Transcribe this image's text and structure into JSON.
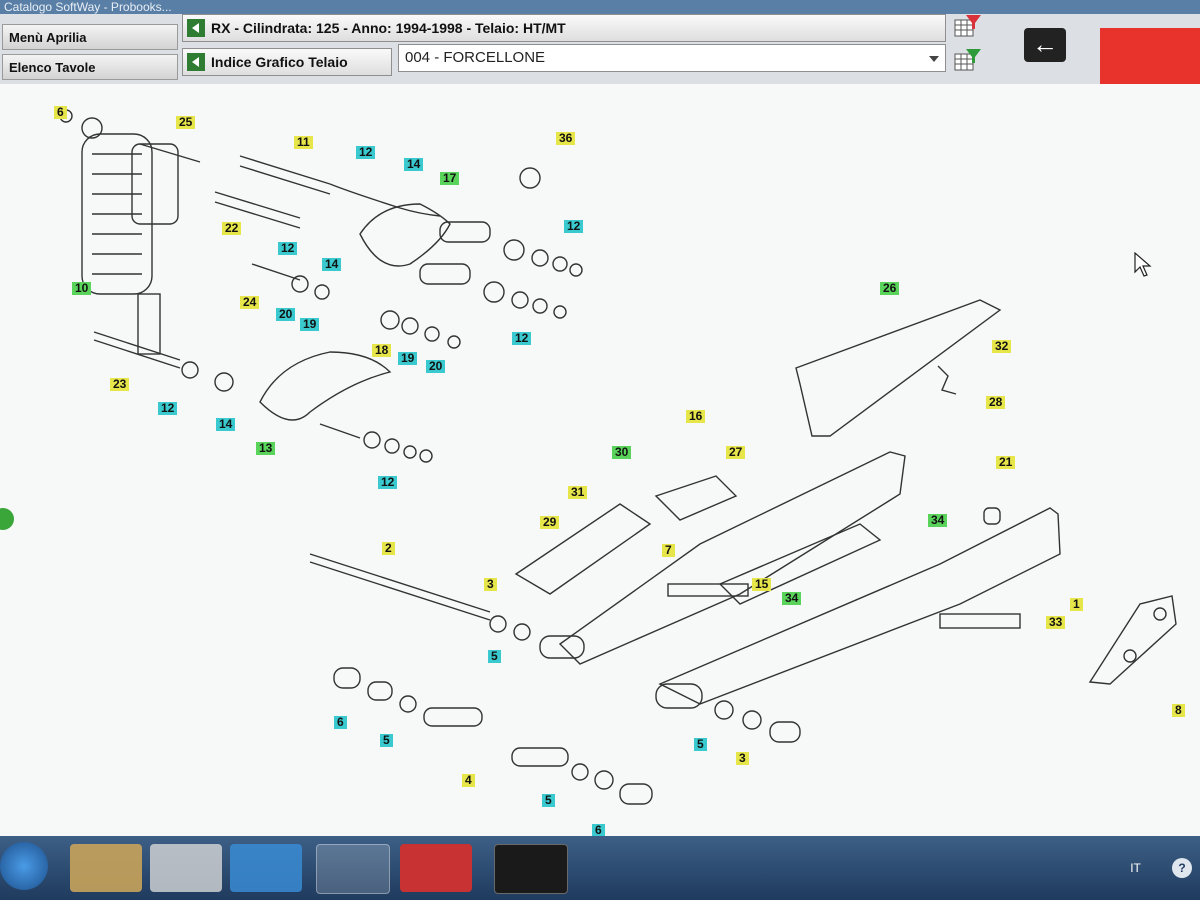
{
  "window": {
    "title": "Catalogo SoftWay - Probooks..."
  },
  "nav": {
    "menu_label": "Menù Aprilia",
    "tables_label": "Elenco Tavole"
  },
  "breadcrumb": {
    "model": "RX - Cilindrata:  125 - Anno: 1994-1998 - Telaio: HT/MT",
    "index": "Indice Grafico Telaio",
    "table": "004 - FORCELLONE"
  },
  "colors": {
    "tag_yellow": "#e6e54a",
    "tag_cyan": "#39c9cf",
    "tag_green": "#5ad35a",
    "header_red": "#e8322c"
  },
  "diagram": {
    "tags": [
      {
        "n": "6",
        "c": "y"
      },
      {
        "n": "25",
        "c": "y"
      },
      {
        "n": "11",
        "c": "y"
      },
      {
        "n": "12",
        "c": "c"
      },
      {
        "n": "14",
        "c": "c"
      },
      {
        "n": "17",
        "c": "g"
      },
      {
        "n": "36",
        "c": "y"
      },
      {
        "n": "22",
        "c": "y"
      },
      {
        "n": "12",
        "c": "c"
      },
      {
        "n": "14",
        "c": "c"
      },
      {
        "n": "12",
        "c": "c"
      },
      {
        "n": "24",
        "c": "y"
      },
      {
        "n": "20",
        "c": "c"
      },
      {
        "n": "19",
        "c": "c"
      },
      {
        "n": "10",
        "c": "g"
      },
      {
        "n": "18",
        "c": "y"
      },
      {
        "n": "19",
        "c": "c"
      },
      {
        "n": "20",
        "c": "c"
      },
      {
        "n": "12",
        "c": "c"
      },
      {
        "n": "23",
        "c": "y"
      },
      {
        "n": "12",
        "c": "c"
      },
      {
        "n": "14",
        "c": "c"
      },
      {
        "n": "13",
        "c": "g"
      },
      {
        "n": "12",
        "c": "c"
      },
      {
        "n": "26",
        "c": "g"
      },
      {
        "n": "32",
        "c": "y"
      },
      {
        "n": "28",
        "c": "y"
      },
      {
        "n": "16",
        "c": "y"
      },
      {
        "n": "30",
        "c": "g"
      },
      {
        "n": "27",
        "c": "y"
      },
      {
        "n": "21",
        "c": "y"
      },
      {
        "n": "31",
        "c": "y"
      },
      {
        "n": "29",
        "c": "y"
      },
      {
        "n": "34",
        "c": "g"
      },
      {
        "n": "7",
        "c": "y"
      },
      {
        "n": "2",
        "c": "y"
      },
      {
        "n": "15",
        "c": "y"
      },
      {
        "n": "34",
        "c": "g"
      },
      {
        "n": "1",
        "c": "y"
      },
      {
        "n": "3",
        "c": "y"
      },
      {
        "n": "33",
        "c": "y"
      },
      {
        "n": "5",
        "c": "c"
      },
      {
        "n": "8",
        "c": "y"
      },
      {
        "n": "6",
        "c": "c"
      },
      {
        "n": "5",
        "c": "c"
      },
      {
        "n": "5",
        "c": "c"
      },
      {
        "n": "3",
        "c": "y"
      },
      {
        "n": "4",
        "c": "y"
      },
      {
        "n": "5",
        "c": "c"
      },
      {
        "n": "6",
        "c": "c"
      }
    ]
  },
  "taskbar": {
    "lang": "IT"
  }
}
